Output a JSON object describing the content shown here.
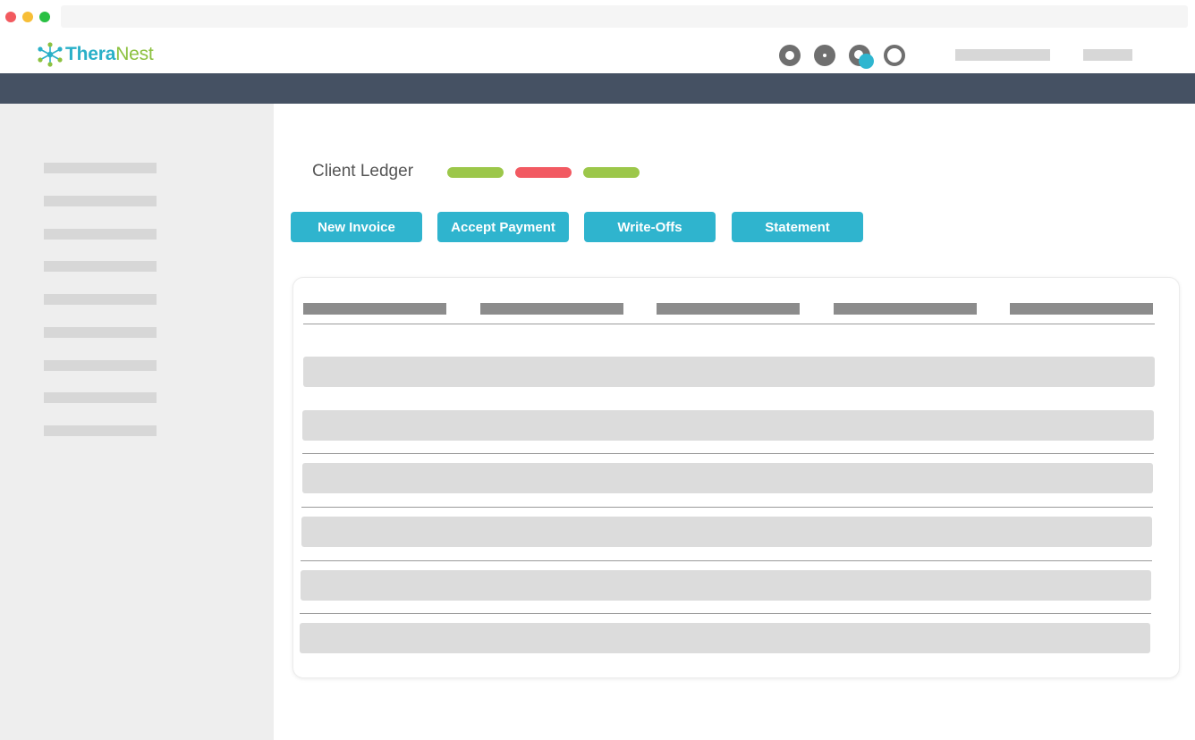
{
  "app": {
    "brand_part1": "Thera",
    "brand_part2": "Nest",
    "brand_colors": {
      "primary": "#2ab0c8",
      "secondary": "#8cc13f"
    }
  },
  "header": {
    "icons": [
      "user-icon",
      "settings-icon",
      "notifications-icon",
      "status-icon"
    ]
  },
  "page": {
    "title": "Client Ledger",
    "status_pills": [
      "#9cc74a",
      "#f25a62",
      "#9cc74a"
    ]
  },
  "actions": {
    "new_invoice": "New Invoice",
    "accept_payment": "Accept Payment",
    "write_offs": "Write-Offs",
    "statement": "Statement"
  },
  "colors": {
    "nav": "#455163",
    "button": "#2fb4ce",
    "sidebar": "#eeeeee"
  }
}
